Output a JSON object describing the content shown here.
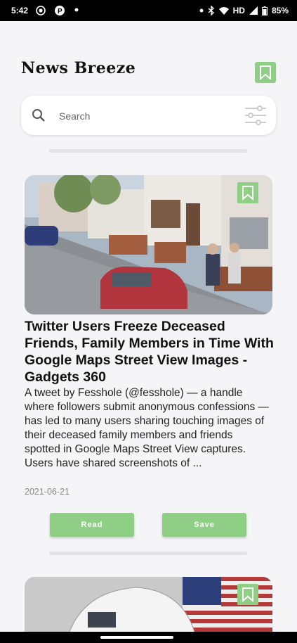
{
  "status": {
    "time": "5:42",
    "network": "HD",
    "battery": "85%"
  },
  "header": {
    "title": "News Breeze",
    "icon": "bookmark-icon",
    "accent": "#8fcf85"
  },
  "search": {
    "placeholder": "Search",
    "value": ""
  },
  "articles": [
    {
      "title": "Twitter Users Freeze Deceased Friends, Family Members in Time With Google Maps Street View Images - Gadgets 360",
      "description": "A tweet by Fesshole (@fesshole) — a handle where followers submit anonymous confessions — has led to many users sharing touching images of their deceased family members and friends spotted in Google Maps Street View captures. Users have shared screenshots of ...",
      "date": "2021-06-21",
      "read_label": "Read",
      "save_label": "Save"
    },
    {
      "title": "",
      "description": "",
      "date": ""
    }
  ]
}
